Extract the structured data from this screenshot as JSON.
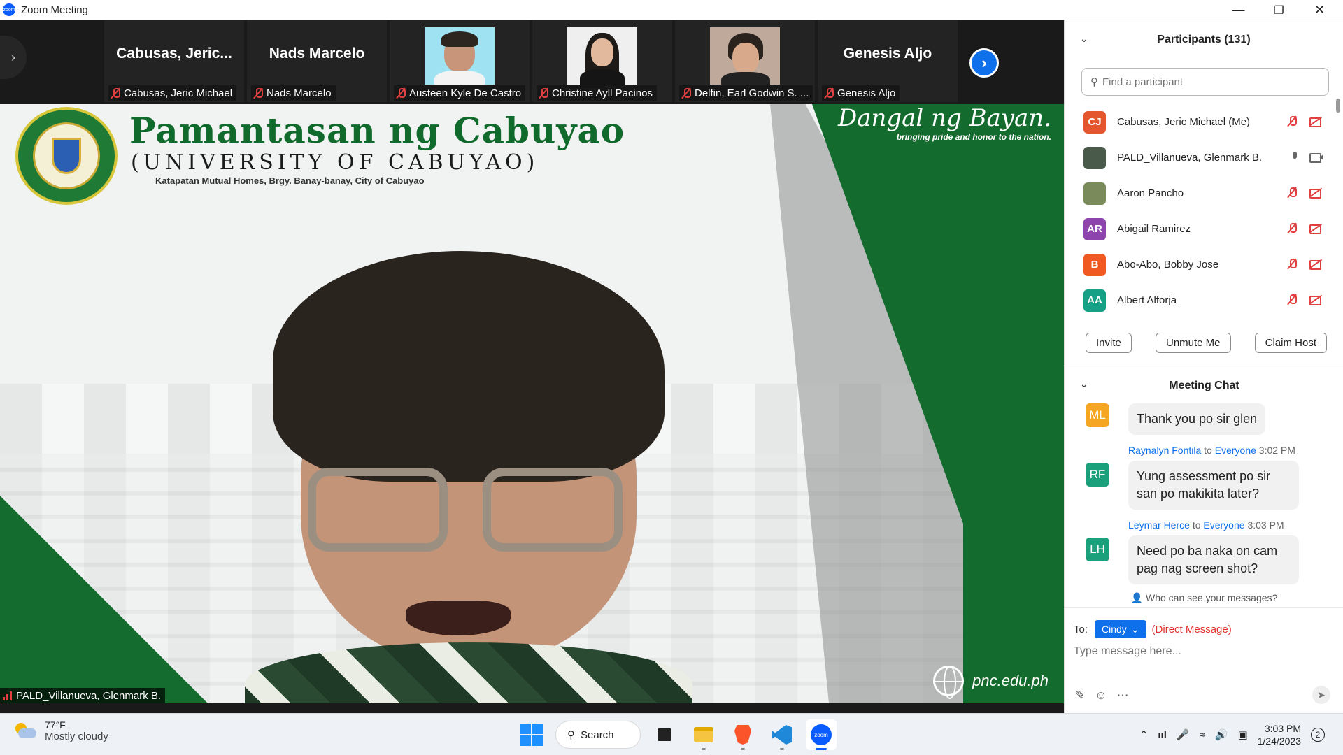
{
  "window": {
    "title": "Zoom Meeting",
    "minimize": "—",
    "restore": "❐",
    "close": "✕"
  },
  "strip": {
    "prev_icon": "chevron-right-icon",
    "tiles": [
      {
        "big_name": "Cabusas,  Jeric...",
        "label": "Cabusas, Jeric Michael",
        "has_video": false
      },
      {
        "big_name": "Nads Marcelo",
        "label": "Nads Marcelo",
        "has_video": false
      },
      {
        "big_name": "",
        "label": "Austeen Kyle De Castro",
        "has_video": true,
        "bg": "#9fe3f2"
      },
      {
        "big_name": "",
        "label": "Christine Ayll Pacinos",
        "has_video": true,
        "bg": "#efefef"
      },
      {
        "big_name": "",
        "label": "Delfin, Earl Godwin S. ...",
        "has_video": true,
        "bg": "#bfa99b"
      },
      {
        "big_name": "Genesis Aljo",
        "label": "Genesis Aljo",
        "has_video": false
      }
    ],
    "next_icon": "chevron-right-icon"
  },
  "main_video": {
    "university_name": "Pamantasan ng Cabuyao",
    "university_sub": "(UNIVERSITY OF CABUYAO)",
    "address": "Katapatan Mutual Homes, Brgy. Banay-banay, City of Cabuyao",
    "motto": "Dangal ng Bayan.",
    "motto_sub": "bringing pride and honor to the nation.",
    "website": "pnc.edu.ph",
    "speaker_label": "PALD_Villanueva, Glenmark B."
  },
  "participants": {
    "title": "Participants (131)",
    "search_placeholder": "Find a participant",
    "list": [
      {
        "initials": "CJ",
        "name": "Cabusas, Jeric Michael (Me)",
        "color": "#e4572e",
        "mic": "off",
        "video": "off"
      },
      {
        "initials": "",
        "name": "PALD_Villanueva, Glenmark B.",
        "color": "#4a5a4a",
        "mic": "on",
        "video": "on"
      },
      {
        "initials": "",
        "name": "Aaron Pancho",
        "color": "#7a8a5a",
        "mic": "off",
        "video": "off"
      },
      {
        "initials": "AR",
        "name": "Abigail Ramirez",
        "color": "#8e44ad",
        "mic": "off",
        "video": "off"
      },
      {
        "initials": "B",
        "name": "Abo-Abo, Bobby Jose",
        "color": "#f05a22",
        "mic": "off",
        "video": "off"
      },
      {
        "initials": "AA",
        "name": "Albert Alforja",
        "color": "#16a085",
        "mic": "off",
        "video": "off"
      }
    ],
    "buttons": {
      "invite": "Invite",
      "unmute": "Unmute Me",
      "claim_host": "Claim Host"
    }
  },
  "chat": {
    "title": "Meeting Chat",
    "messages": [
      {
        "initials": "ML",
        "color": "#f5a623",
        "from": "",
        "to": "",
        "time": "",
        "text": "Thank you po sir glen"
      },
      {
        "initials": "RF",
        "color": "#1aa07a",
        "from": "Raynalyn Fontila",
        "to": "Everyone",
        "time": "3:02 PM",
        "text": "Yung assessment po sir san po makikita later?"
      },
      {
        "initials": "LH",
        "color": "#1aa07a",
        "from": "Leymar Herce",
        "to": "Everyone",
        "time": "3:03 PM",
        "text": "Need po ba naka on cam pag nag screen shot?"
      }
    ],
    "to_word": "to",
    "who_can_see": "Who can see your messages?",
    "to_label": "To:",
    "recipient": "Cindy",
    "direct_message": "(Direct Message)",
    "input_placeholder": "Type message here..."
  },
  "taskbar": {
    "weather_temp": "77°F",
    "weather_cond": "Mostly cloudy",
    "search_label": "Search",
    "time": "3:03 PM",
    "date": "1/24/2023",
    "notifications": "2"
  }
}
